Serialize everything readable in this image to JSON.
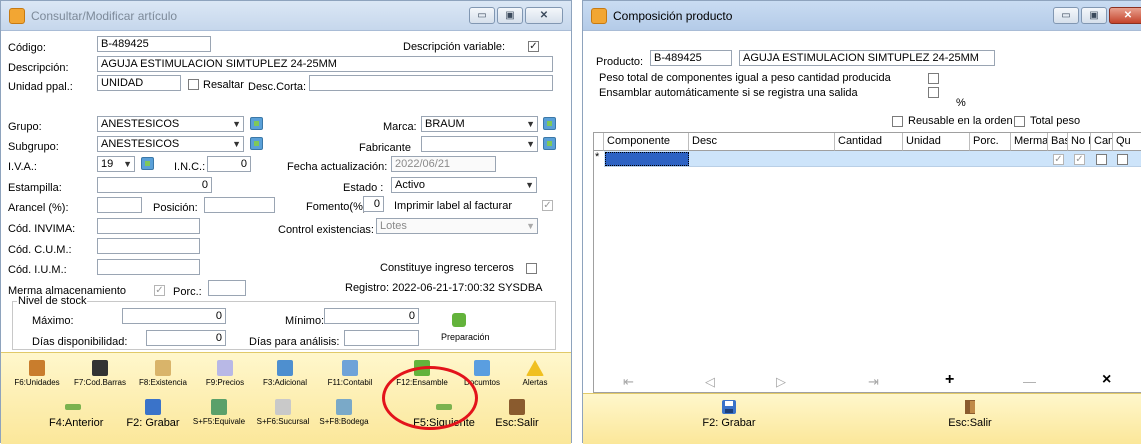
{
  "win1": {
    "title": "Consultar/Modificar artículo",
    "codigo_label": "Código:",
    "codigo": "B-489425",
    "desc_var_label": "Descripción variable:",
    "desc_var_checked": "✓",
    "descripcion_label": "Descripción:",
    "descripcion": "AGUJA ESTIMULACION SIMTUPLEZ 24-25MM",
    "unidad_label": "Unidad ppal.:",
    "unidad": "UNIDAD",
    "resaltar_label": "Resaltar",
    "desc_corta_label": "Desc.Corta:",
    "grupo_label": "Grupo:",
    "grupo": "ANESTESICOS",
    "marca_label": "Marca:",
    "marca": "BRAUM",
    "subgrupo_label": "Subgrupo:",
    "subgrupo": "ANESTESICOS",
    "fabricante_label": "Fabricante",
    "iva_label": "I.V.A.:",
    "iva": "19",
    "inc_label": "I.N.C.:",
    "inc": "0",
    "fecha_label": "Fecha actualización:",
    "fecha": "2022/06/21",
    "estampilla_label": "Estampilla:",
    "estampilla": "0",
    "estado_label": "Estado :",
    "estado": "Activo",
    "arancel_label": "Arancel (%):",
    "posicion_label": "Posición:",
    "fomento_label": "Fomento(%):",
    "fomento": "0",
    "imprimir_label": "Imprimir label al facturar",
    "invima_label": "Cód. INVIMA:",
    "control_label": "Control existencias:",
    "control": "Lotes",
    "cum_label": "Cód. C.U.M.:",
    "ium_label": "Cód. I.U.M.:",
    "constituye_label": "Constituye ingreso terceros",
    "merma_label": "Merma almacenamiento",
    "merma_checked": "✓",
    "porc_label": "Porc.:",
    "registro": "Registro: 2022-06-21-17:00:32 SYSDBA",
    "nivel_label": "Nivel de stock",
    "maximo_label": "Máximo:",
    "maximo": "0",
    "minimo_label": "Mínimo:",
    "minimo": "0",
    "dias_disp_label": "Días disponibilidad:",
    "dias_disp": "0",
    "dias_analisis_label": "Días para análisis:",
    "preparacion_label": "Preparación",
    "toolbar1": [
      "F6:Unidades",
      "F7:Cod.Barras",
      "F8:Existencia",
      "F9:Precios",
      "F3:Adicional",
      "F11:Contabil",
      "F12:Ensamble",
      "Documtos",
      "Alertas"
    ],
    "toolbar2": [
      "F4:Anterior",
      "F2: Grabar",
      "S+F5:Equivale",
      "S+F6:Sucursal",
      "S+F8:Bodega",
      "F5:Siguiente",
      "Esc:Salir"
    ]
  },
  "win2": {
    "title": "Composición producto",
    "producto_label": "Producto:",
    "producto_codigo": "B-489425",
    "producto_desc": "AGUJA ESTIMULACION SIMTUPLEZ 24-25MM",
    "peso_label": "Peso total de componentes igual a peso cantidad producida",
    "ensamblar_label": "Ensamblar automáticamente si se registra una salida",
    "percent_sign": "%",
    "reusable_label": "Reusable en la orden",
    "total_peso_label": "Total peso",
    "columns": [
      "Componente",
      "Desc",
      "Cantidad",
      "Unidad",
      "Porc.",
      "Merma",
      "Bas",
      "No M",
      "Caml",
      "Qu"
    ],
    "row_marker": "*",
    "grabar": "F2: Grabar",
    "salir": "Esc:Salir",
    "nav_add": "+",
    "nav_delete": "×"
  },
  "colors": {
    "toolbar": "#fbe79a",
    "highlight_circle": "#e3131b",
    "selected_row": "#cde4fa"
  }
}
